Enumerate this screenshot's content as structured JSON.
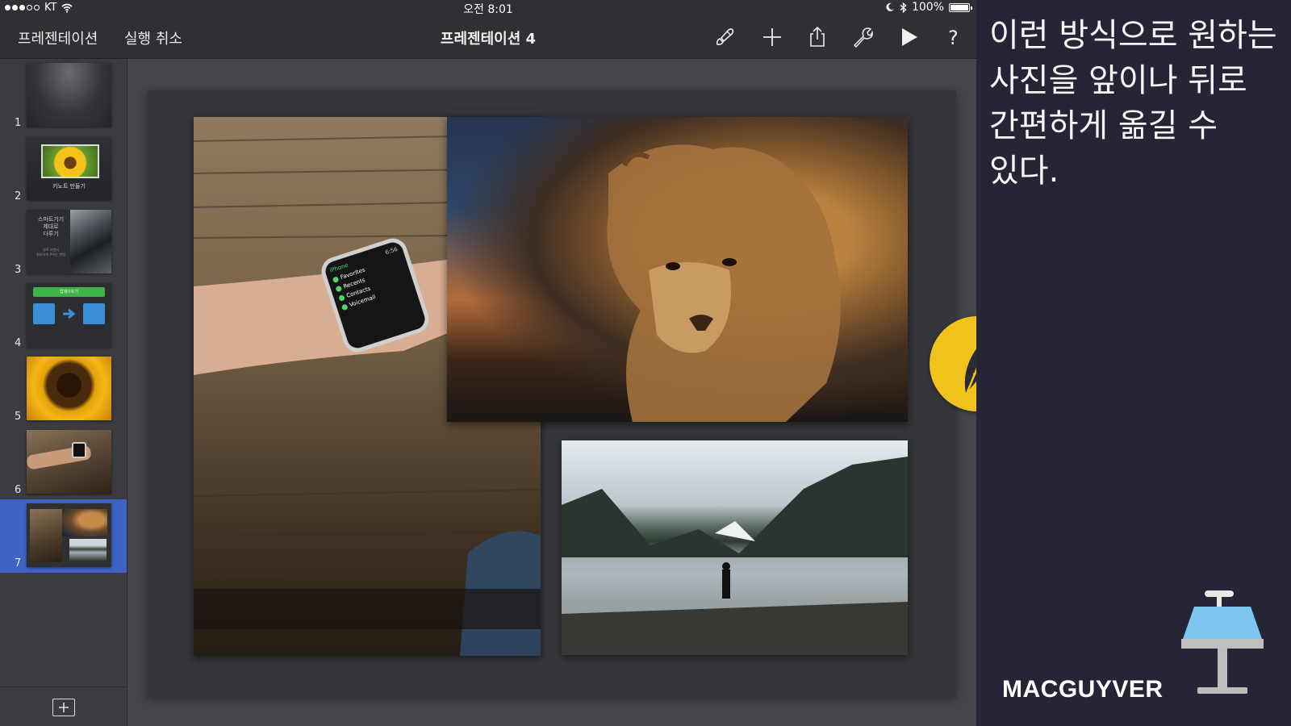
{
  "status_bar": {
    "carrier": "KT",
    "time": "오전 8:01",
    "battery": "100%",
    "battery_level": 1.0,
    "signal_bars": 3
  },
  "toolbar": {
    "presentations_label": "프레젠테이션",
    "undo_label": "실행 취소",
    "doc_title": "프레젠테이션 4",
    "icons": [
      "paintbrush-icon",
      "plus-icon",
      "share-icon",
      "wrench-icon",
      "play-icon",
      "help-icon"
    ],
    "help_glyph": "?"
  },
  "navigator": {
    "selected": 7,
    "slides": [
      {
        "num": "1",
        "texts": []
      },
      {
        "num": "2",
        "texts": [
          "키노트 만들기"
        ]
      },
      {
        "num": "3",
        "texts": [
          "스마트기기",
          "제대로",
          "다루기",
          "글로 쓰면서",
          "편리하게 주어는 방법"
        ]
      },
      {
        "num": "4",
        "texts": [
          "업데이트기"
        ]
      },
      {
        "num": "5",
        "texts": []
      },
      {
        "num": "6",
        "texts": []
      },
      {
        "num": "7",
        "texts": []
      }
    ]
  },
  "watch_menu": [
    "iPhone",
    "6:56",
    "Favorites",
    "Recents",
    "Contacts",
    "Voicemail"
  ],
  "panel": {
    "caption": "이런 방식으로 원하는 사진을 앞이나 뒤로 간편하게 옮길 수 있다.",
    "brand": "MACGUYVER",
    "logo_icon": "keynote-podium-icon",
    "badge_icon": "feather-icon"
  },
  "colors": {
    "selection": "#3e63c4",
    "badge": "#f1c21b",
    "keynote_blue": "#7cc7ef",
    "panel_bg": "#262536"
  }
}
